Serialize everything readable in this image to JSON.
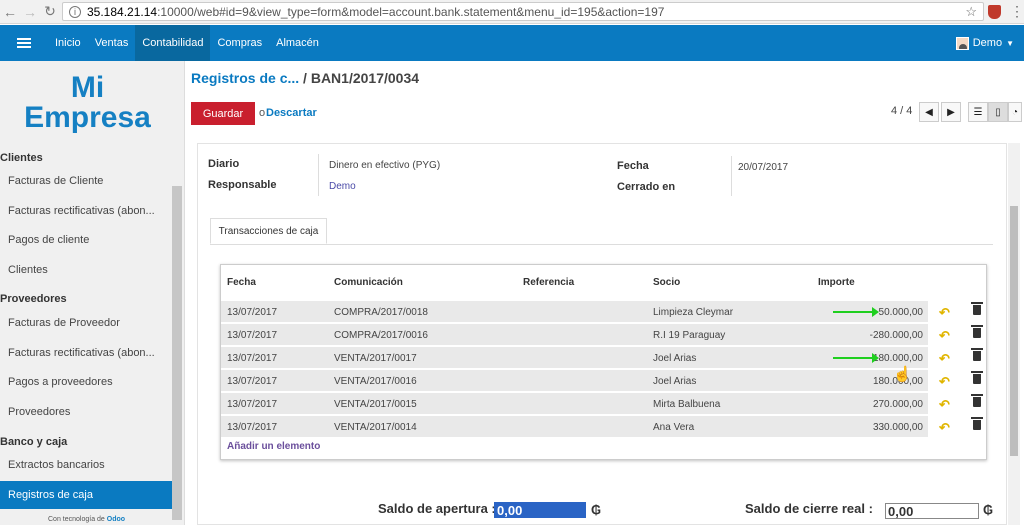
{
  "browser": {
    "url_host": "35.184.21.14",
    "url_rest": ":10000/web#id=9&view_type=form&model=account.bank.statement&menu_id=195&action=197"
  },
  "topbar": {
    "menu": [
      "Inicio",
      "Ventas",
      "Contabilidad",
      "Compras",
      "Almacén"
    ],
    "user": "Demo"
  },
  "sidebar": {
    "logo_line1": "Mi",
    "logo_line2": "Empresa",
    "section_clientes": "Clientes",
    "clientes_items": [
      "Facturas de Cliente",
      "Facturas rectificativas (abon...",
      "Pagos de cliente",
      "Clientes"
    ],
    "section_proveedores": "Proveedores",
    "proveedores_items": [
      "Facturas de Proveedor",
      "Facturas rectificativas (abon...",
      "Pagos a proveedores",
      "Proveedores"
    ],
    "section_banco": "Banco y caja",
    "banco_items": [
      "Extractos bancarios",
      "Registros de caja"
    ],
    "powered_prefix": "Con tecnología de",
    "powered_brand": "Odoo"
  },
  "header": {
    "breadcrumb_parent": "Registros de c...",
    "breadcrumb_sep": " / ",
    "breadcrumb_current": "BAN1/2017/0034",
    "save": "Guardar",
    "or": "o",
    "discard": "Descartar",
    "pager": "4 / 4"
  },
  "form": {
    "diario_label": "Diario",
    "diario_value": "Dinero en efectivo (PYG)",
    "responsable_label": "Responsable",
    "responsable_value": "Demo",
    "fecha_label": "Fecha",
    "fecha_value": "20/07/2017",
    "cerrado_label": "Cerrado en",
    "tab": "Transacciones de caja"
  },
  "table": {
    "headers": [
      "Fecha",
      "Comunicación",
      "Referencia",
      "Socio",
      "Importe"
    ],
    "rows": [
      {
        "fecha": "13/07/2017",
        "com": "COMPRA/2017/0018",
        "ref": "",
        "socio": "Limpieza Cleymar",
        "importe": "-50.000,00"
      },
      {
        "fecha": "13/07/2017",
        "com": "COMPRA/2017/0016",
        "ref": "",
        "socio": "R.I 19 Paraguay",
        "importe": "-280.000,00"
      },
      {
        "fecha": "13/07/2017",
        "com": "VENTA/2017/0017",
        "ref": "",
        "socio": "Joel Arias",
        "importe": "180.000,00"
      },
      {
        "fecha": "13/07/2017",
        "com": "VENTA/2017/0016",
        "ref": "",
        "socio": "Joel Arias",
        "importe": "180.000,00"
      },
      {
        "fecha": "13/07/2017",
        "com": "VENTA/2017/0015",
        "ref": "",
        "socio": "Mirta Balbuena",
        "importe": "270.000,00"
      },
      {
        "fecha": "13/07/2017",
        "com": "VENTA/2017/0014",
        "ref": "",
        "socio": "Ana Vera",
        "importe": "330.000,00"
      }
    ],
    "add_line": "Añadir un elemento"
  },
  "balance": {
    "opening_label": "Saldo de apertura :",
    "opening_value": "0,00",
    "closing_label": "Saldo de cierre real :",
    "closing_value": "0,00",
    "currency": "₲"
  },
  "colors": {
    "brand": "#0a7ac1",
    "save": "#c91f2e",
    "arrow": "#1fcf1f"
  }
}
